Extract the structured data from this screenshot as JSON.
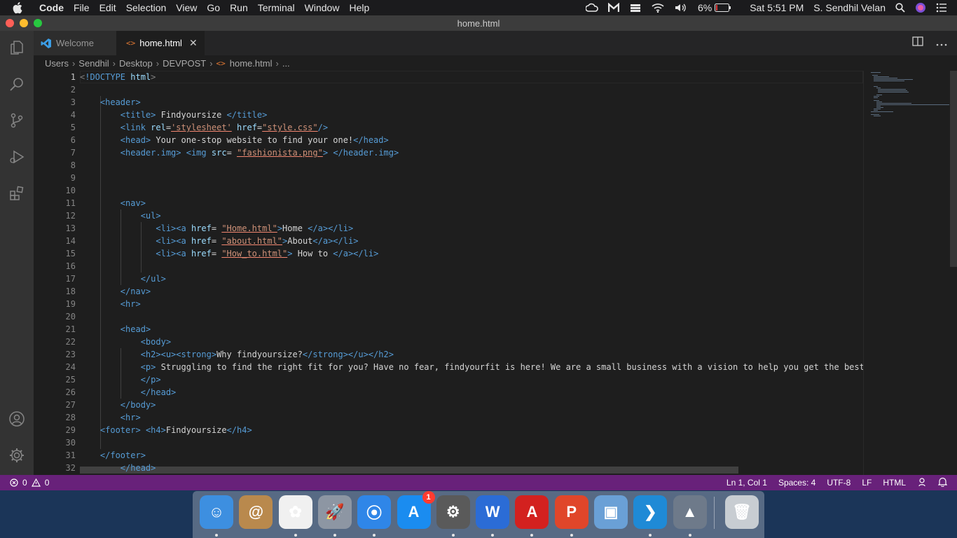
{
  "menubar": {
    "app_name": "Code",
    "menus": [
      "File",
      "Edit",
      "Selection",
      "View",
      "Go",
      "Run",
      "Terminal",
      "Window",
      "Help"
    ],
    "battery": "6%",
    "clock": "Sat 5:51 PM",
    "user": "S. Sendhil Velan"
  },
  "window": {
    "title": "home.html"
  },
  "tabs": [
    {
      "label": "Welcome",
      "active": false
    },
    {
      "label": "home.html",
      "active": true
    }
  ],
  "breadcrumb": [
    "Users",
    "Sendhil",
    "Desktop",
    "DEVPOST",
    "home.html",
    "..."
  ],
  "editor": {
    "language": "HTML",
    "current_line": 1,
    "line_numbers": [
      "1",
      "2",
      "3",
      "4",
      "5",
      "6",
      "7",
      "8",
      "9",
      "10",
      "11",
      "12",
      "13",
      "14",
      "15",
      "16",
      "17",
      "18",
      "19",
      "20",
      "21",
      "22",
      "23",
      "24",
      "25",
      "26",
      "27",
      "28",
      "29",
      "30",
      "31",
      "32"
    ],
    "lines": [
      [
        [
          "br",
          "<"
        ],
        [
          "tag",
          "!DOCTYPE"
        ],
        [
          "txt",
          " "
        ],
        [
          "attr",
          "html"
        ],
        [
          "br",
          ">"
        ]
      ],
      [],
      [
        [
          "txt",
          "    "
        ],
        [
          "tag",
          "<header>"
        ]
      ],
      [
        [
          "txt",
          "        "
        ],
        [
          "tag",
          "<title>"
        ],
        [
          "txt",
          " Findyoursize "
        ],
        [
          "tag",
          "</title>"
        ]
      ],
      [
        [
          "txt",
          "        "
        ],
        [
          "tag",
          "<link"
        ],
        [
          "txt",
          " "
        ],
        [
          "attr",
          "rel"
        ],
        [
          "txt",
          "="
        ],
        [
          "str",
          "'stylesheet'"
        ],
        [
          "txt",
          " "
        ],
        [
          "attr",
          "href"
        ],
        [
          "txt",
          "="
        ],
        [
          "str",
          "\"style.css\""
        ],
        [
          "tag",
          "/>"
        ]
      ],
      [
        [
          "txt",
          "        "
        ],
        [
          "tag",
          "<head>"
        ],
        [
          "txt",
          " Your one-stop website to find your one!"
        ],
        [
          "tag",
          "</head>"
        ]
      ],
      [
        [
          "txt",
          "        "
        ],
        [
          "tag",
          "<header.img>"
        ],
        [
          "txt",
          " "
        ],
        [
          "tag",
          "<img"
        ],
        [
          "txt",
          " "
        ],
        [
          "attr",
          "src"
        ],
        [
          "txt",
          "= "
        ],
        [
          "str",
          "\"fashionista.png\""
        ],
        [
          "tag",
          ">"
        ],
        [
          "txt",
          " "
        ],
        [
          "tag",
          "</header.img>"
        ]
      ],
      [],
      [],
      [],
      [
        [
          "txt",
          "        "
        ],
        [
          "tag",
          "<nav>"
        ]
      ],
      [
        [
          "txt",
          "            "
        ],
        [
          "tag",
          "<ul>"
        ]
      ],
      [
        [
          "txt",
          "               "
        ],
        [
          "tag",
          "<li><a"
        ],
        [
          "txt",
          " "
        ],
        [
          "attr",
          "href"
        ],
        [
          "txt",
          "= "
        ],
        [
          "str",
          "\"Home.html\""
        ],
        [
          "tag",
          ">"
        ],
        [
          "txt",
          "Home "
        ],
        [
          "tag",
          "</a></li>"
        ]
      ],
      [
        [
          "txt",
          "               "
        ],
        [
          "tag",
          "<li><a"
        ],
        [
          "txt",
          " "
        ],
        [
          "attr",
          "href"
        ],
        [
          "txt",
          "= "
        ],
        [
          "str",
          "\"about.html\""
        ],
        [
          "tag",
          ">"
        ],
        [
          "txt",
          "About"
        ],
        [
          "tag",
          "</a></li>"
        ]
      ],
      [
        [
          "txt",
          "               "
        ],
        [
          "tag",
          "<li><a"
        ],
        [
          "txt",
          " "
        ],
        [
          "attr",
          "href"
        ],
        [
          "txt",
          "= "
        ],
        [
          "str",
          "\"How_to.html\""
        ],
        [
          "tag",
          ">"
        ],
        [
          "txt",
          " How to "
        ],
        [
          "tag",
          "</a></li>"
        ]
      ],
      [],
      [
        [
          "txt",
          "            "
        ],
        [
          "tag",
          "</ul>"
        ]
      ],
      [
        [
          "txt",
          "        "
        ],
        [
          "tag",
          "</nav>"
        ]
      ],
      [
        [
          "txt",
          "        "
        ],
        [
          "tag",
          "<hr>"
        ]
      ],
      [],
      [
        [
          "txt",
          "        "
        ],
        [
          "tag",
          "<head>"
        ]
      ],
      [
        [
          "txt",
          "            "
        ],
        [
          "tag",
          "<body>"
        ]
      ],
      [
        [
          "txt",
          "            "
        ],
        [
          "tag",
          "<h2><u><strong>"
        ],
        [
          "txt",
          "Why findyoursize?"
        ],
        [
          "tag",
          "</strong></u></h2>"
        ]
      ],
      [
        [
          "txt",
          "            "
        ],
        [
          "tag",
          "<p>"
        ],
        [
          "txt",
          " Struggling to find the right fit for you? Have no fear, findyourfit is here! We are a small business with a vision to help you get the best"
        ]
      ],
      [
        [
          "txt",
          "            "
        ],
        [
          "tag",
          "</p>"
        ]
      ],
      [
        [
          "txt",
          "            "
        ],
        [
          "tag",
          "</head>"
        ]
      ],
      [
        [
          "txt",
          "        "
        ],
        [
          "tag",
          "</body>"
        ]
      ],
      [
        [
          "txt",
          "        "
        ],
        [
          "tag",
          "<hr>"
        ]
      ],
      [
        [
          "txt",
          "    "
        ],
        [
          "tag",
          "<footer>"
        ],
        [
          "txt",
          " "
        ],
        [
          "tag",
          "<h4>"
        ],
        [
          "txt",
          "Findyoursize"
        ],
        [
          "tag",
          "</h4>"
        ]
      ],
      [],
      [
        [
          "txt",
          "    "
        ],
        [
          "tag",
          "</footer>"
        ]
      ],
      [
        [
          "txt",
          "        "
        ],
        [
          "tag",
          "</head>"
        ]
      ]
    ]
  },
  "statusbar": {
    "errors": "0",
    "warnings": "0",
    "position": "Ln 1, Col 1",
    "spaces": "Spaces: 4",
    "encoding": "UTF-8",
    "eol": "LF",
    "language": "HTML"
  },
  "dock": {
    "apps": [
      {
        "name": "Finder",
        "icon": "finder-icon",
        "color": "#3d8fe0"
      },
      {
        "name": "Contacts",
        "icon": "contacts-icon",
        "color": "#b9894d"
      },
      {
        "name": "Photos",
        "icon": "photos-icon",
        "color": "#f0f0f0"
      },
      {
        "name": "Launchpad",
        "icon": "launchpad-icon",
        "color": "#8d96a3"
      },
      {
        "name": "Safari",
        "icon": "safari-icon",
        "color": "#2f86e8"
      },
      {
        "name": "App Store",
        "icon": "app-store-icon",
        "color": "#1a8cf0"
      },
      {
        "name": "System Preferences",
        "icon": "system-preferences-icon",
        "color": "#5a5a5a"
      },
      {
        "name": "Word",
        "icon": "word-icon",
        "color": "#2b6cd6"
      },
      {
        "name": "Acrobat",
        "icon": "acrobat-icon",
        "color": "#d3211f"
      },
      {
        "name": "PowerPoint",
        "icon": "powerpoint-icon",
        "color": "#e0462a"
      },
      {
        "name": "Preview",
        "icon": "preview-icon",
        "color": "#6aa0d6"
      },
      {
        "name": "Visual Studio Code",
        "icon": "vscode-icon",
        "color": "#1f8ad6"
      },
      {
        "name": "Rocket Typist",
        "icon": "rocket-icon",
        "color": "#6e7a8a"
      },
      {
        "name": "Trash",
        "icon": "trash-icon",
        "color": "#c8cdd2"
      }
    ],
    "app_store_badge": "1"
  }
}
